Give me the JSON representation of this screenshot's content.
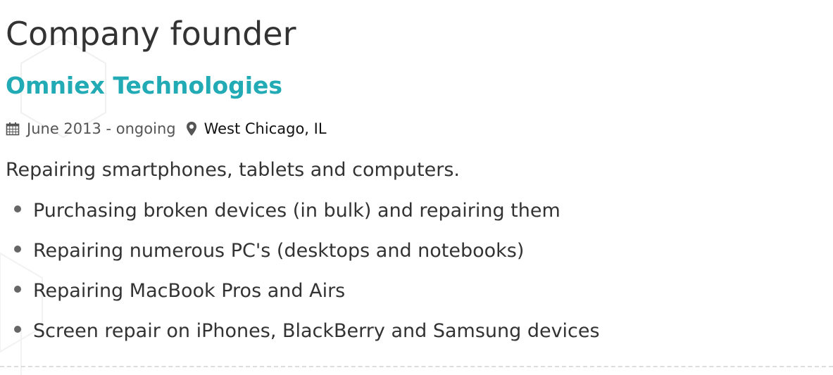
{
  "job": {
    "title": "Company founder",
    "company": "Omniex Technologies",
    "date_range": "June 2013 - ongoing",
    "location": "West Chicago, IL",
    "summary": "Repairing smartphones, tablets and computers.",
    "bullets": [
      "Purchasing broken devices (in bulk) and repairing them",
      "Repairing numerous PC's (desktops and notebooks)",
      "Repairing MacBook Pros and Airs",
      "Screen repair on iPhones, BlackBerry and Samsung devices"
    ]
  },
  "icons": {
    "date": "calendar-icon",
    "location": "map-pin-icon"
  },
  "colors": {
    "accent": "#22aab5",
    "text": "#333333",
    "divider": "#dddddd"
  }
}
